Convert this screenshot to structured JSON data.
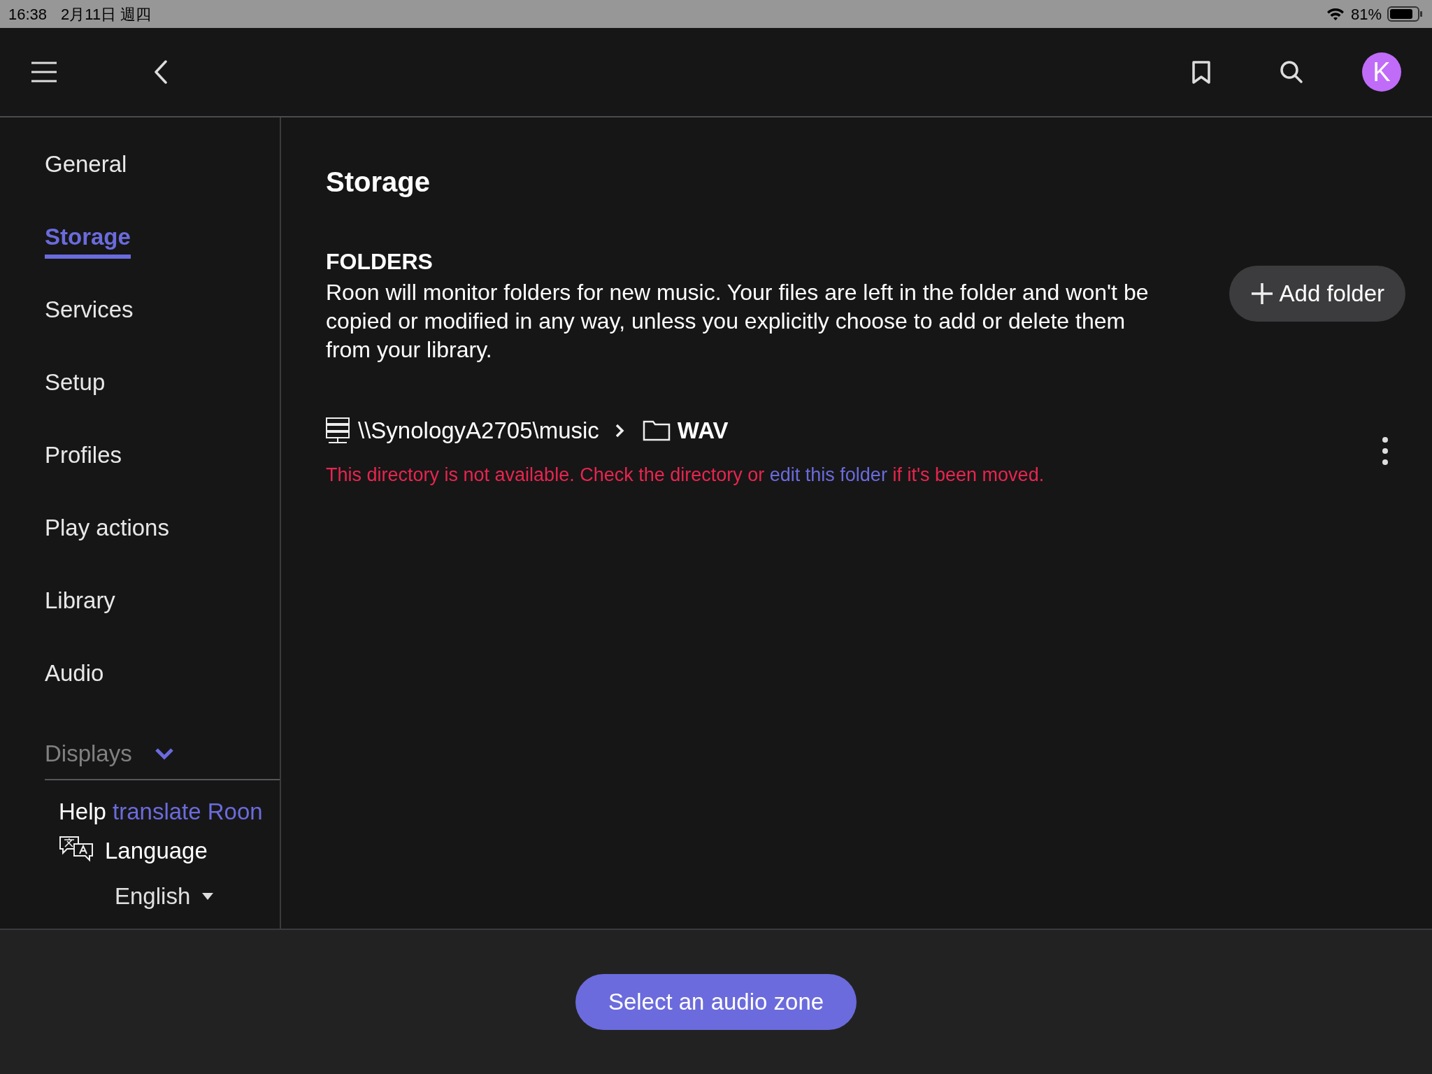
{
  "status_bar": {
    "time": "16:38",
    "date": "2月11日 週四",
    "battery": "81%"
  },
  "top_bar": {
    "avatar": "K"
  },
  "sidebar": {
    "items": [
      {
        "label": "General",
        "selected": false
      },
      {
        "label": "Storage",
        "selected": true
      },
      {
        "label": "Services",
        "selected": false
      },
      {
        "label": "Setup",
        "selected": false
      },
      {
        "label": "Profiles",
        "selected": false
      },
      {
        "label": "Play actions",
        "selected": false
      },
      {
        "label": "Library",
        "selected": false
      },
      {
        "label": "Audio",
        "selected": false
      }
    ],
    "section": {
      "label": "Displays",
      "expanded": true
    },
    "help_text": "Help",
    "help_link": "translate Roon",
    "language_label": "Language",
    "language_value": "English"
  },
  "content": {
    "title": "Storage",
    "heading": "FOLDERS",
    "description": "Roon will monitor folders for new music. Your files are left in the folder and won't be copied or modified in any way, unless you explicitly choose to add or delete them from your library.",
    "add_button": "Add folder",
    "folders": [
      {
        "server": "\\\\SynologyA2705\\music",
        "folder": "WAV",
        "error_before": "This directory is not available. Check the directory or",
        "error_link": "edit this folder",
        "error_after": "if it's been moved."
      }
    ]
  },
  "footer": {
    "zone_button": "Select an audio zone"
  }
}
